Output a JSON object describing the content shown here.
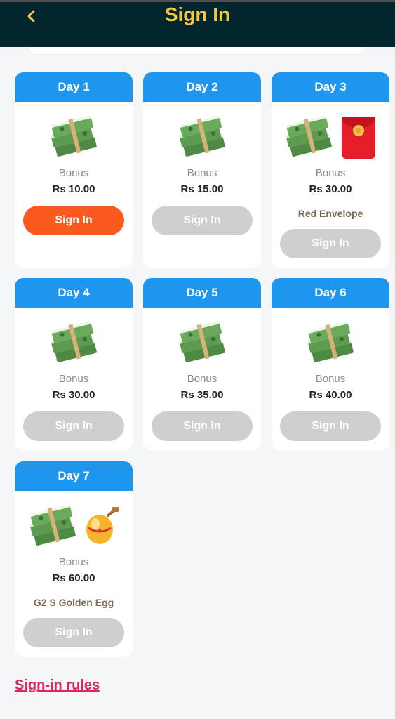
{
  "header": {
    "title": "Sign In"
  },
  "days": [
    {
      "day": "Day 1",
      "bonus_label": "Bonus",
      "amount": "Rs 10.00",
      "button": "Sign In"
    },
    {
      "day": "Day 2",
      "bonus_label": "Bonus",
      "amount": "Rs 15.00",
      "button": "Sign In"
    },
    {
      "day": "Day 3",
      "bonus_label": "Bonus",
      "amount": "Rs 30.00",
      "extra": "Red Envelope",
      "button": "Sign In"
    },
    {
      "day": "Day 4",
      "bonus_label": "Bonus",
      "amount": "Rs 30.00",
      "button": "Sign In"
    },
    {
      "day": "Day 5",
      "bonus_label": "Bonus",
      "amount": "Rs 35.00",
      "button": "Sign In"
    },
    {
      "day": "Day 6",
      "bonus_label": "Bonus",
      "amount": "Rs 40.00",
      "button": "Sign In"
    },
    {
      "day": "Day 7",
      "bonus_label": "Bonus",
      "amount": "Rs 60.00",
      "extra": "G2 S Golden Egg",
      "button": "Sign In"
    }
  ],
  "footer": {
    "rules_link": "Sign-in rules"
  },
  "colors": {
    "header_bg": "#03262c",
    "title": "#f4c741",
    "card_head": "#1f96ee",
    "active_button": "#fb5a1e",
    "disabled_button": "#cfcfcf",
    "rules_link": "#e0245e"
  }
}
